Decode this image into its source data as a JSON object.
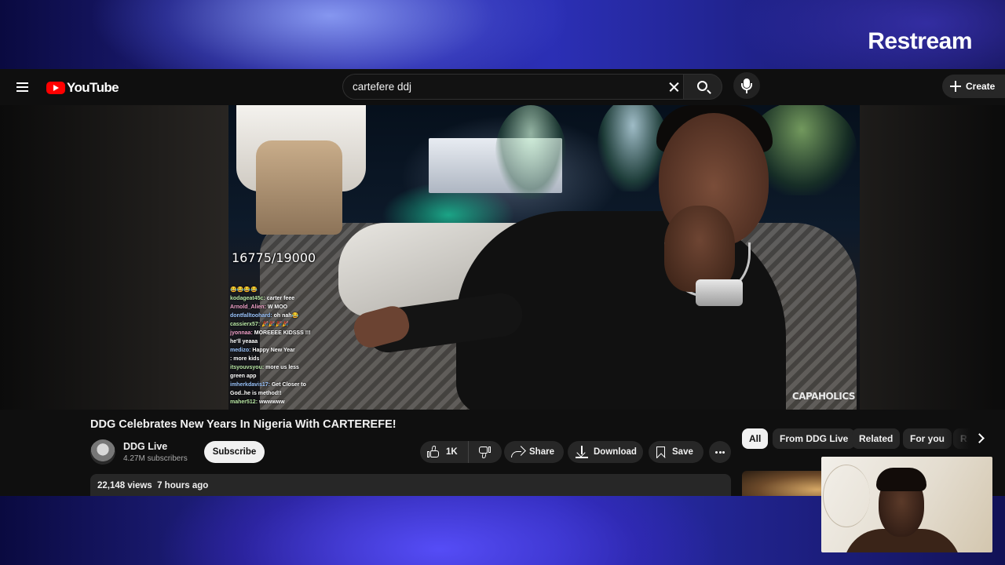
{
  "overlay": {
    "brand": "Restream"
  },
  "youtube": {
    "logo_text": "YouTube",
    "search": {
      "value": "cartefere ddj",
      "placeholder": "Search"
    },
    "create_label": "Create",
    "video": {
      "counter": "16775/19000",
      "watermark": "CAPAHOLICS",
      "chat": [
        {
          "user": "",
          "text": "😂😂😂😂"
        },
        {
          "user": "kodageat45c:",
          "text": "carter feee"
        },
        {
          "user": "Arnold_Alien:",
          "text": "W MOO"
        },
        {
          "user": "dontfalltoohard:",
          "text": "oh nah😂"
        },
        {
          "user": "cassierx57:",
          "text": "🎉🎉🎉🎉"
        },
        {
          "user": "jyonnaa:",
          "text": "MOREEEE KIDSSS !!!"
        },
        {
          "user": "",
          "text": "he'll yeaaa"
        },
        {
          "user": "medizo:",
          "text": "Happy New Year"
        },
        {
          "user": "",
          "text": ": more kids"
        },
        {
          "user": "itsyouvsyou:",
          "text": "more us less"
        },
        {
          "user": "",
          "text": "green app"
        },
        {
          "user": "imherkdavis17:",
          "text": "Get Closer to"
        },
        {
          "user": "",
          "text": "God..he is method!!"
        },
        {
          "user": "maher512:",
          "text": "wwwwww"
        }
      ]
    },
    "title": "DDG Celebrates New Years In Nigeria With CARTEREFE!",
    "channel": {
      "name": "DDG Live",
      "subscribers": "4.27M subscribers",
      "subscribe_label": "Subscribe"
    },
    "actions": {
      "like_count": "1K",
      "share": "Share",
      "download": "Download",
      "save": "Save"
    },
    "description": {
      "views": "22,148 views",
      "age": "7 hours ago"
    },
    "chips": [
      "All",
      "From DDG Live",
      "Related",
      "For you",
      "R"
    ]
  },
  "colors": {
    "youtube_red": "#ff0000",
    "yt_background": "#0f0f0f",
    "pill_bg": "#272727",
    "restream_gradient": "#2b2fb5"
  }
}
